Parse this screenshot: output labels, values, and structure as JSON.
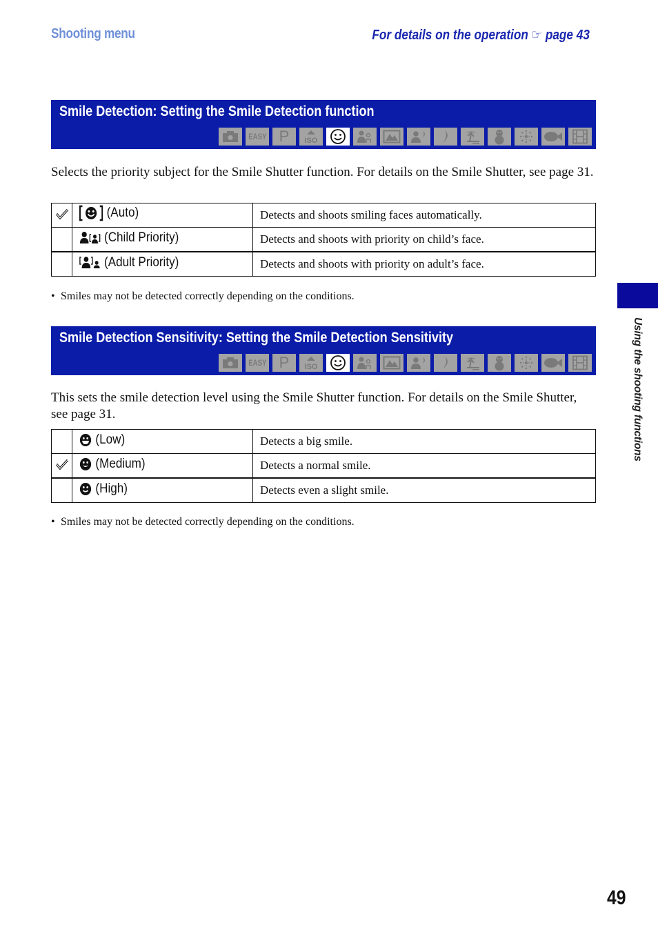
{
  "header": {
    "section": "Shooting menu",
    "reference_text": "For details on the operation",
    "reference_icon": "pointing-hand-icon",
    "reference_page": "page 43"
  },
  "mode_icons": [
    {
      "name": "auto-camera-icon",
      "label": "",
      "active": false
    },
    {
      "name": "easy-mode-icon",
      "label": "EASY",
      "active": false
    },
    {
      "name": "program-mode-icon",
      "label": "P",
      "active": false
    },
    {
      "name": "high-iso-icon",
      "label": "ISO",
      "active": false
    },
    {
      "name": "smile-shutter-icon",
      "label": "",
      "active": true
    },
    {
      "name": "soft-snap-icon",
      "label": "",
      "active": false
    },
    {
      "name": "landscape-icon",
      "label": "",
      "active": false
    },
    {
      "name": "twilight-portrait-icon",
      "label": "",
      "active": false
    },
    {
      "name": "twilight-icon",
      "label": "",
      "active": false
    },
    {
      "name": "beach-icon",
      "label": "",
      "active": false
    },
    {
      "name": "snow-icon",
      "label": "",
      "active": false
    },
    {
      "name": "fireworks-icon",
      "label": "",
      "active": false
    },
    {
      "name": "underwater-icon",
      "label": "",
      "active": false
    },
    {
      "name": "movie-mode-icon",
      "label": "",
      "active": false
    }
  ],
  "sections": [
    {
      "title": "Smile Detection: Setting the Smile Detection function",
      "description": "Selects the priority subject for the Smile Shutter function. For details on the Smile Shutter, see page 31.",
      "options": [
        {
          "icon": "auto-face-icon",
          "label": "(Auto)",
          "description": "Detects and shoots smiling faces automatically.",
          "default": true
        },
        {
          "icon": "child-priority-icon",
          "label": "(Child Priority)",
          "description": "Detects and shoots with priority on child’s face.",
          "default": false
        },
        {
          "icon": "adult-priority-icon",
          "label": "(Adult Priority)",
          "description": "Detects and shoots with priority on adult’s face.",
          "default": false
        }
      ],
      "note": "Smiles may not be detected correctly depending on the conditions."
    },
    {
      "title": "Smile Detection Sensitivity: Setting the Smile Detection Sensitivity",
      "description": "This sets the smile detection level using the Smile Shutter function. For details on the Smile Shutter, see page 31.",
      "options": [
        {
          "icon": "smile-low-icon",
          "label": "(Low)",
          "description": "Detects a big smile.",
          "default": false
        },
        {
          "icon": "smile-medium-icon",
          "label": "(Medium)",
          "description": "Detects a normal smile.",
          "default": true
        },
        {
          "icon": "smile-high-icon",
          "label": "(High)",
          "description": "Detects even a slight smile.",
          "default": false
        }
      ],
      "note": "Smiles may not be detected correctly depending on the conditions."
    }
  ],
  "sidebar": {
    "chapter": "Using the shooting functions"
  },
  "bullet": "•",
  "page_number": "49",
  "colors": {
    "banner": "#0a1ca8",
    "header_section": "#6f8fd8",
    "header_reference": "#1a27b0",
    "mode_icon_bg": "#a3a3a3",
    "side_tab": "#0a0a9c"
  }
}
